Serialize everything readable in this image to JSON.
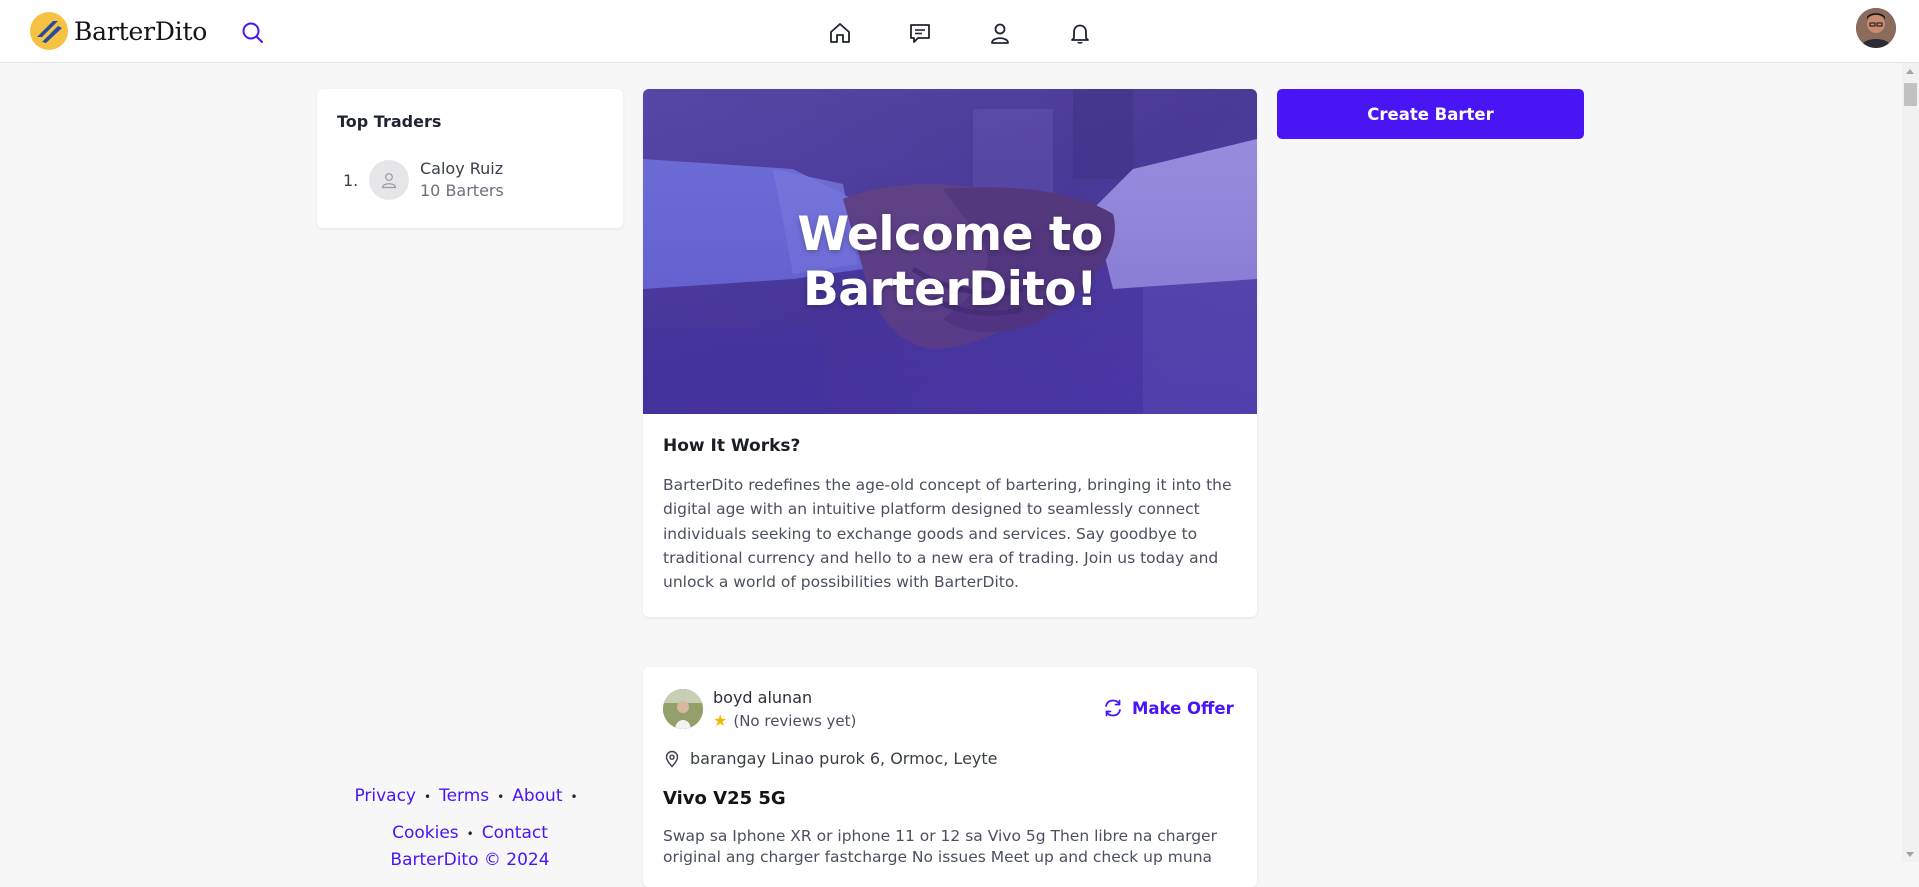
{
  "header": {
    "brand": "BarterDito",
    "colors": {
      "accent": "#4a15f5",
      "logo_yellow": "#f5c243",
      "logo_blue": "#2a4aa0"
    },
    "icons": [
      "search-icon",
      "home-icon",
      "chat-icon",
      "profile-icon",
      "bell-icon"
    ]
  },
  "top_traders": {
    "title": "Top Traders",
    "items": [
      {
        "rank": "1.",
        "name": "Caloy Ruiz",
        "barters": "10 Barters"
      }
    ]
  },
  "welcome": {
    "hero_title": "Welcome to BarterDito!",
    "how_title": "How It Works?",
    "how_text": "BarterDito redefines the age-old concept of bartering, bringing it into the digital age with an intuitive platform designed to seamlessly connect individuals seeking to exchange goods and services. Say goodbye to traditional currency and hello to a new era of trading. Join us today and unlock a world of possibilities with BarterDito."
  },
  "actions": {
    "create_barter": "Create Barter"
  },
  "post": {
    "user": "boyd alunan",
    "rating": "(No reviews yet)",
    "make_offer": "Make Offer",
    "location": "barangay Linao purok 6, Ormoc, Leyte",
    "title": "Vivo V25 5G",
    "description": "Swap sa Iphone XR or iphone 11 or 12 sa Vivo 5g Then libre na charger original ang charger fastcharge No issues Meet up and check up muna"
  },
  "footer": {
    "privacy": "Privacy",
    "terms": "Terms",
    "about": "About",
    "cookies": "Cookies",
    "contact": "Contact",
    "copyright": "BarterDito © 2024"
  }
}
